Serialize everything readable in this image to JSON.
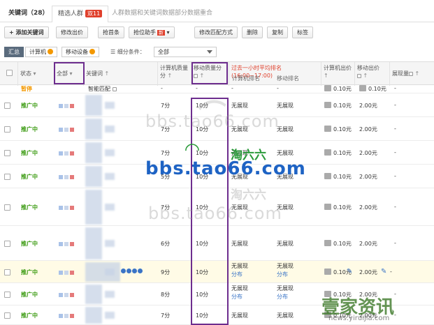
{
  "tabs": {
    "keywords_label": "关键词（28）",
    "selected_label": "精选人群",
    "selected_badge": "双11",
    "merge_note": "人群数据和关键词数据部分数据重合"
  },
  "toolbar": {
    "add": "+ 添加关键词",
    "modify_price": "修改出价",
    "grab": "抢首条",
    "rank_helper": "抢位助手",
    "rank_helper_badge": "新",
    "modify_match": "修改匹配方式",
    "delete": "删除",
    "copy": "复制",
    "tag": "标签"
  },
  "filters": {
    "summary": "汇总",
    "computer": "计算机",
    "mobile": "移动设备",
    "sub_condition_label": "细分条件：",
    "sub_condition_value": "全部"
  },
  "header": {
    "status": "状态",
    "all": "全部",
    "keyword": "关键词",
    "pc_quality": "计算机质量分",
    "mobile_quality": "移动质量分",
    "avg_rank": "过去一小时平均排名(16:00~17:00)",
    "pc_rank": "计算机排名",
    "mobile_rank": "移动排名",
    "pc_bid": "计算机出价",
    "mobile_bid": "移动出价",
    "impressions": "展现量"
  },
  "rows": [
    {
      "status": "暂停",
      "keyword": "智能匹配",
      "pc_q": "-",
      "m_q": "-",
      "pc_rank": "-",
      "m_rank": "-",
      "pc_bid": "0.10元",
      "m_bid": "0.10元",
      "imp": "-"
    },
    {
      "status": "推广中",
      "keyword": "",
      "pc_q": "7分",
      "m_q": "10分",
      "pc_rank": "无展现",
      "m_rank": "无展现",
      "pc_bid": "0.10元",
      "m_bid": "2.00元",
      "imp": "-"
    },
    {
      "status": "推广中",
      "keyword": "",
      "pc_q": "7分",
      "m_q": "10分",
      "pc_rank": "无展现",
      "m_rank": "无展现",
      "pc_bid": "0.10元",
      "m_bid": "2.00元",
      "imp": "-"
    },
    {
      "status": "推广中",
      "keyword": "",
      "pc_q": "7分",
      "m_q": "10分",
      "pc_rank": "无展现",
      "m_rank": "无展现",
      "pc_bid": "0.10元",
      "m_bid": "2.00元",
      "imp": "-"
    },
    {
      "status": "推广中",
      "keyword": "",
      "pc_q": "5分",
      "m_q": "10分",
      "pc_rank": "无展现",
      "m_rank": "无展现",
      "pc_bid": "0.10元",
      "m_bid": "2.00元",
      "imp": "-"
    },
    {
      "status": "推广中",
      "keyword": "",
      "pc_q": "7分",
      "m_q": "10分",
      "pc_rank": "无展现",
      "m_rank": "无展现",
      "pc_bid": "0.10元",
      "m_bid": "2.00元",
      "imp": "-"
    },
    {
      "status": "推广中",
      "keyword": "",
      "pc_q": "6分",
      "m_q": "10分",
      "pc_rank": "无展现",
      "m_rank": "无展现",
      "pc_bid": "0.10元",
      "m_bid": "2.00元",
      "imp": "-"
    },
    {
      "status": "推广中",
      "keyword": "",
      "pc_q": "9分",
      "m_q": "10分",
      "pc_rank": "无展现",
      "m_rank": "无展现",
      "pc_rank_sub": "分布",
      "m_rank_sub": "分布",
      "pc_bid": "0.10元",
      "m_bid": "2.00元",
      "imp": "-"
    },
    {
      "status": "推广中",
      "keyword": "",
      "pc_q": "8分",
      "m_q": "10分",
      "pc_rank": "无展现",
      "m_rank": "无展现",
      "pc_rank_sub": "分布",
      "m_rank_sub": "分布",
      "pc_bid": "0.10元",
      "m_bid": "2.00元",
      "imp": "-"
    },
    {
      "status": "推广中",
      "keyword": "",
      "pc_q": "7分",
      "m_q": "10分",
      "pc_rank": "无展现",
      "m_rank": "无展现",
      "pc_bid": "0.10元",
      "m_bid": "2.00元",
      "imp": "-"
    }
  ],
  "watermarks": {
    "w1": "bbs.tao66.com",
    "w2": "淘六六",
    "w3": "bbs.tao66.com",
    "w4": "淘六六",
    "w5": "bbs.tao66.com",
    "w6": "壹家资讯",
    "w7": "news.yiruijia.com"
  },
  "colors": {
    "active_status": "#3a9a10",
    "paused_status": "#f39800",
    "highlight_box": "#6d2d8e",
    "alert_red": "#e0402c"
  }
}
